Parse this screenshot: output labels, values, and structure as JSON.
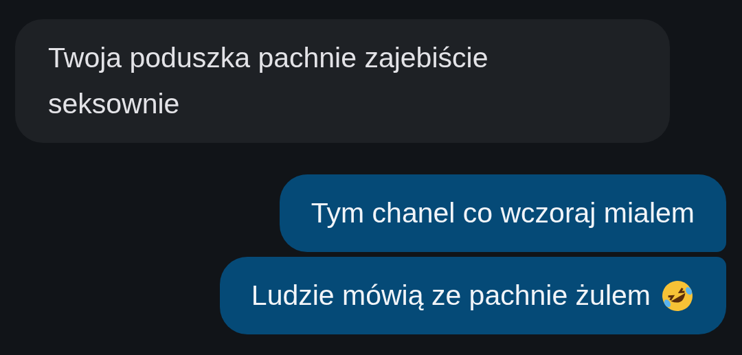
{
  "messages": [
    {
      "kind": "received",
      "text": "Twoja poduszka pachnie zajebiście seksownie"
    },
    {
      "kind": "sent",
      "text": "Tym chanel co wczoraj mialem"
    },
    {
      "kind": "sent",
      "text": "Ludzie mówią ze pachnie żulem",
      "laughing_emoji": true
    }
  ]
}
